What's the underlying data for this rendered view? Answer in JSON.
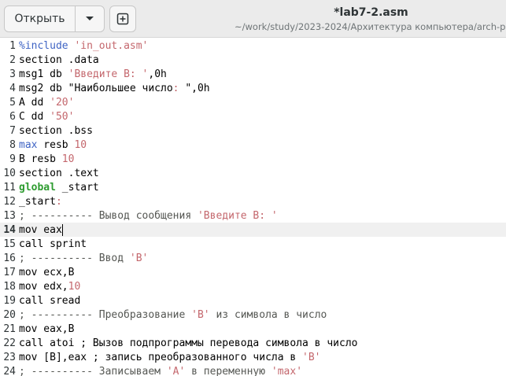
{
  "header": {
    "open_label": "Открыть",
    "title": "*lab7-2.asm",
    "path": "~/work/study/2023-2024/Архитектура компьютера/arch-pc/lab"
  },
  "lines": [
    {
      "n": "1",
      "tokens": [
        {
          "t": "%include ",
          "c": "reg"
        },
        {
          "t": "'in_out.asm'",
          "c": "str"
        }
      ]
    },
    {
      "n": "2",
      "tokens": [
        {
          "t": "section .data",
          "c": ""
        }
      ]
    },
    {
      "n": "3",
      "tokens": [
        {
          "t": "msg1 db ",
          "c": ""
        },
        {
          "t": "'Введите В: '",
          "c": "str"
        },
        {
          "t": ",0h",
          "c": ""
        }
      ]
    },
    {
      "n": "4",
      "tokens": [
        {
          "t": "msg2 db \"Наибольшее число",
          "c": ""
        },
        {
          "t": ":",
          "c": "str"
        },
        {
          "t": " \",0h",
          "c": ""
        }
      ]
    },
    {
      "n": "5",
      "tokens": [
        {
          "t": "A dd ",
          "c": ""
        },
        {
          "t": "'20'",
          "c": "str"
        }
      ]
    },
    {
      "n": "6",
      "tokens": [
        {
          "t": "C dd ",
          "c": ""
        },
        {
          "t": "'50'",
          "c": "str"
        }
      ]
    },
    {
      "n": "7",
      "tokens": [
        {
          "t": "section .bss",
          "c": ""
        }
      ]
    },
    {
      "n": "8",
      "tokens": [
        {
          "t": "max",
          "c": "reg"
        },
        {
          "t": " resb ",
          "c": ""
        },
        {
          "t": "10",
          "c": "num"
        }
      ]
    },
    {
      "n": "9",
      "tokens": [
        {
          "t": "B resb ",
          "c": ""
        },
        {
          "t": "10",
          "c": "num"
        }
      ]
    },
    {
      "n": "10",
      "tokens": [
        {
          "t": "section .text",
          "c": ""
        }
      ]
    },
    {
      "n": "11",
      "tokens": [
        {
          "t": "global",
          "c": "kw"
        },
        {
          "t": " _start",
          "c": ""
        }
      ]
    },
    {
      "n": "12",
      "tokens": [
        {
          "t": "_start",
          "c": ""
        },
        {
          "t": ":",
          "c": "str"
        }
      ]
    },
    {
      "n": "13",
      "tokens": [
        {
          "t": "; ---------- Вывод сообщения ",
          "c": "cm"
        },
        {
          "t": "'Введите В: '",
          "c": "str"
        }
      ]
    },
    {
      "n": "14",
      "tokens": [
        {
          "t": "mov eax",
          "c": ""
        }
      ],
      "current": true
    },
    {
      "n": "15",
      "tokens": [
        {
          "t": "call sprint",
          "c": ""
        }
      ]
    },
    {
      "n": "16",
      "tokens": [
        {
          "t": "; ---------- Ввод ",
          "c": "cm"
        },
        {
          "t": "'B'",
          "c": "str"
        }
      ]
    },
    {
      "n": "17",
      "tokens": [
        {
          "t": "mov ecx,B",
          "c": ""
        }
      ]
    },
    {
      "n": "18",
      "tokens": [
        {
          "t": "mov edx,",
          "c": ""
        },
        {
          "t": "10",
          "c": "num"
        }
      ]
    },
    {
      "n": "19",
      "tokens": [
        {
          "t": "call sread",
          "c": ""
        }
      ]
    },
    {
      "n": "20",
      "tokens": [
        {
          "t": "; ---------- Преобразование ",
          "c": "cm"
        },
        {
          "t": "'B'",
          "c": "str"
        },
        {
          "t": " из символа в число",
          "c": "cm"
        }
      ]
    },
    {
      "n": "21",
      "tokens": [
        {
          "t": "mov eax,B",
          "c": ""
        }
      ]
    },
    {
      "n": "22",
      "tokens": [
        {
          "t": "call atoi ; Вызов подпрограммы перевода символа в число",
          "c": ""
        }
      ]
    },
    {
      "n": "23",
      "tokens": [
        {
          "t": "mov [B],eax ; запись преобразованного числа в ",
          "c": ""
        },
        {
          "t": "'B'",
          "c": "str"
        }
      ]
    },
    {
      "n": "24",
      "tokens": [
        {
          "t": "; ---------- Записываем ",
          "c": "cm"
        },
        {
          "t": "'A'",
          "c": "str"
        },
        {
          "t": " в переменную ",
          "c": "cm"
        },
        {
          "t": "'max'",
          "c": "str"
        }
      ]
    }
  ]
}
